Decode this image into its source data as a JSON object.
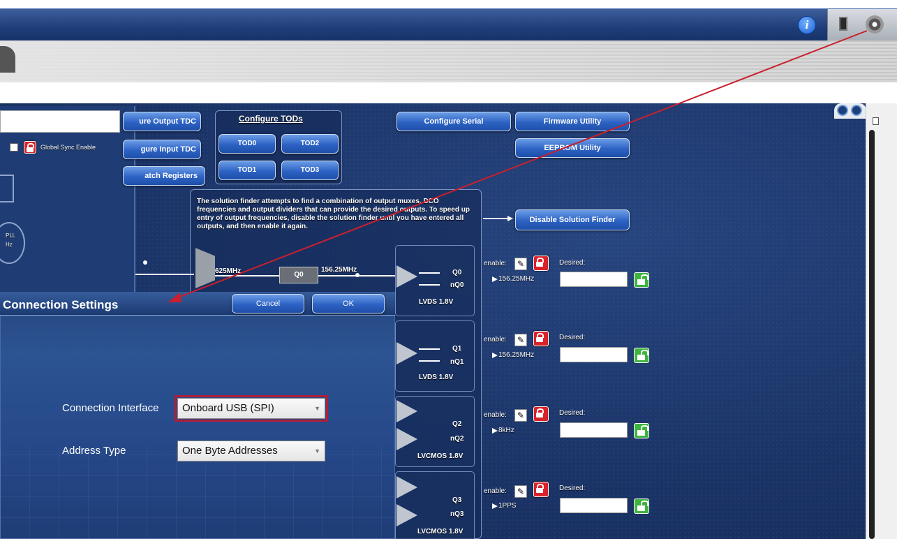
{
  "titlebar": {
    "info_glyph": "i"
  },
  "toolbar": {
    "configure_output_tdc": "ure Output TDC",
    "configure_input_tdc": "gure Input TDC",
    "latch_registers": "atch Registers",
    "configure_tods_title": "Configure TODs",
    "tod0": "TOD0",
    "tod1": "TOD1",
    "tod2": "TOD2",
    "tod3": "TOD3",
    "configure_serial": "Configure Serial",
    "firmware_utility": "Firmware Utility",
    "eeprom_utility": "EEPROM Utility",
    "disable_solution_finder": "Disable Solution Finder"
  },
  "left_panel": {
    "global_sync_label": "Global Sync Enable",
    "pll_label": "PLL",
    "hz_label": "Hz"
  },
  "solution_finder_text": "The solution finder attempts to find a combination of output muxes, DCO frequencies and output dividers that can provide the desired outputs. To speed up entry of output frequencies, disable the solution finder until you have entered all outputs, and then enable it again.",
  "signal": {
    "input_freq": "625MHz",
    "mux_label": "Q0",
    "div_freq": "156.25MHz"
  },
  "outputs": [
    {
      "p": "Q0",
      "n": "nQ0",
      "standard": "LVDS 1.8V",
      "enable_label": "enable:",
      "desired_label": "Desired:",
      "freq": "156.25MHz"
    },
    {
      "p": "Q1",
      "n": "nQ1",
      "standard": "LVDS 1.8V",
      "enable_label": "enable:",
      "desired_label": "Desired:",
      "freq": "156.25MHz"
    },
    {
      "p": "Q2",
      "n": "nQ2",
      "standard": "LVCMOS 1.8V",
      "enable_label": "enable:",
      "desired_label": "Desired:",
      "freq": "8kHz"
    },
    {
      "p": "Q3",
      "n": "nQ3",
      "standard": "LVCMOS 1.8V",
      "enable_label": "enable:",
      "desired_label": "Desired:",
      "freq": "1PPS"
    }
  ],
  "dialog": {
    "title": "Connection Settings",
    "cancel": "Cancel",
    "ok": "OK",
    "connection_interface_label": "Connection Interface",
    "connection_interface_value": "Onboard USB (SPI)",
    "address_type_label": "Address Type",
    "address_type_value": "One Byte Addresses"
  },
  "colors": {
    "accent": "#2d62c4",
    "annotation": "#c8202e",
    "background": "#1c3668"
  }
}
